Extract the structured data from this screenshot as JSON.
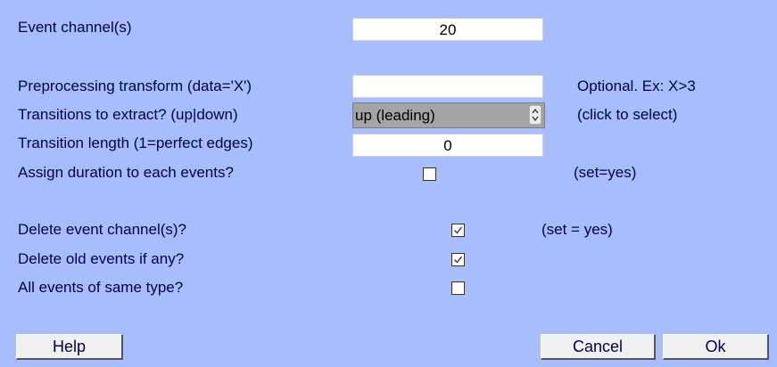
{
  "form": {
    "event_channels": {
      "label": "Event channel(s)",
      "value": "20"
    },
    "preprocessing": {
      "label": "Preprocessing transform (data='X')",
      "value": "",
      "note": "Optional. Ex: X>3"
    },
    "transitions": {
      "label": "Transitions to extract? (up|down)",
      "selected": "up (leading)",
      "note": "(click to select)"
    },
    "transition_length": {
      "label": "Transition length (1=perfect edges)",
      "value": "0"
    },
    "assign_duration": {
      "label": "Assign duration to each events?",
      "checked": false,
      "note": "(set=yes)"
    },
    "delete_channels": {
      "label": "Delete event channel(s)?",
      "checked": true,
      "note": "(set = yes)"
    },
    "delete_old_events": {
      "label": "Delete old events if any?",
      "checked": true
    },
    "same_type": {
      "label": "All events of same type?",
      "checked": false
    }
  },
  "buttons": {
    "help": "Help",
    "cancel": "Cancel",
    "ok": "Ok"
  },
  "icons": {
    "spinner": "up-down-arrows-icon",
    "checkmark": "checkmark-icon"
  },
  "colors": {
    "background": "#a8bdfc",
    "text": "#000052",
    "select_bg": "#a4a4a4"
  }
}
